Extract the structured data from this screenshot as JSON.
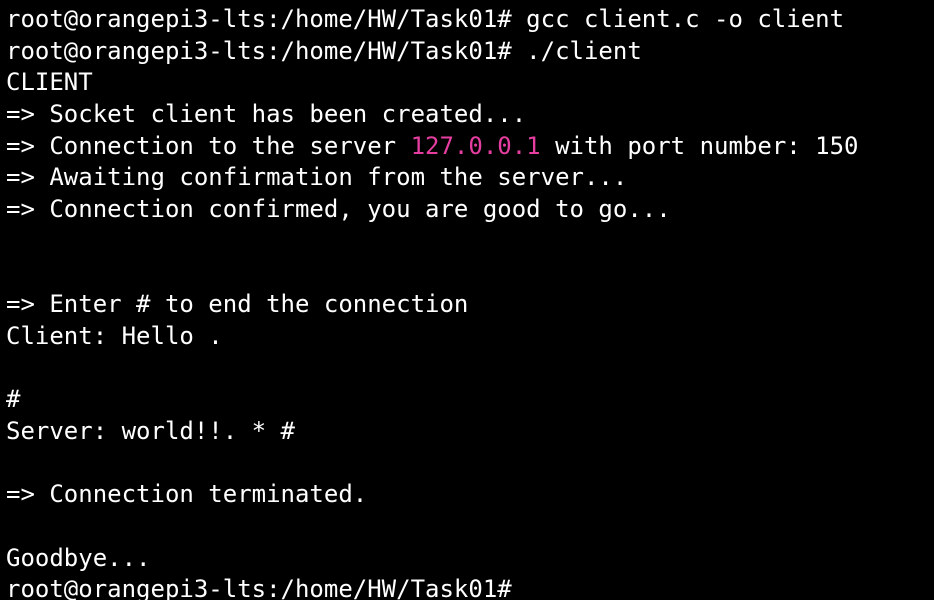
{
  "terminal": {
    "colors": {
      "background": "#000000",
      "foreground": "#ffffff",
      "highlight": "#e63ea0"
    },
    "lines": {
      "l1": "root@orangepi3-lts:/home/HW/Task01# gcc client.c -o client",
      "l2": "root@orangepi3-lts:/home/HW/Task01# ./client",
      "l3": "CLIENT",
      "l4": "=> Socket client has been created...",
      "l5_prefix": "=> Connection to the server ",
      "l5_ip": "127.0.0.1",
      "l5_suffix": " with port number: 150",
      "l6": "=> Awaiting confirmation from the server...",
      "l7": "=> Connection confirmed, you are good to go...",
      "l8": "",
      "l9": "",
      "l10": "=> Enter # to end the connection",
      "l11": "Client: Hello .",
      "l12": "",
      "l13": "#",
      "l14": "Server: world!!. * #",
      "l15": "",
      "l16": "=> Connection terminated.",
      "l17": "",
      "l18": "Goodbye...",
      "l19": "root@orangepi3-lts:/home/HW/Task01#"
    }
  }
}
